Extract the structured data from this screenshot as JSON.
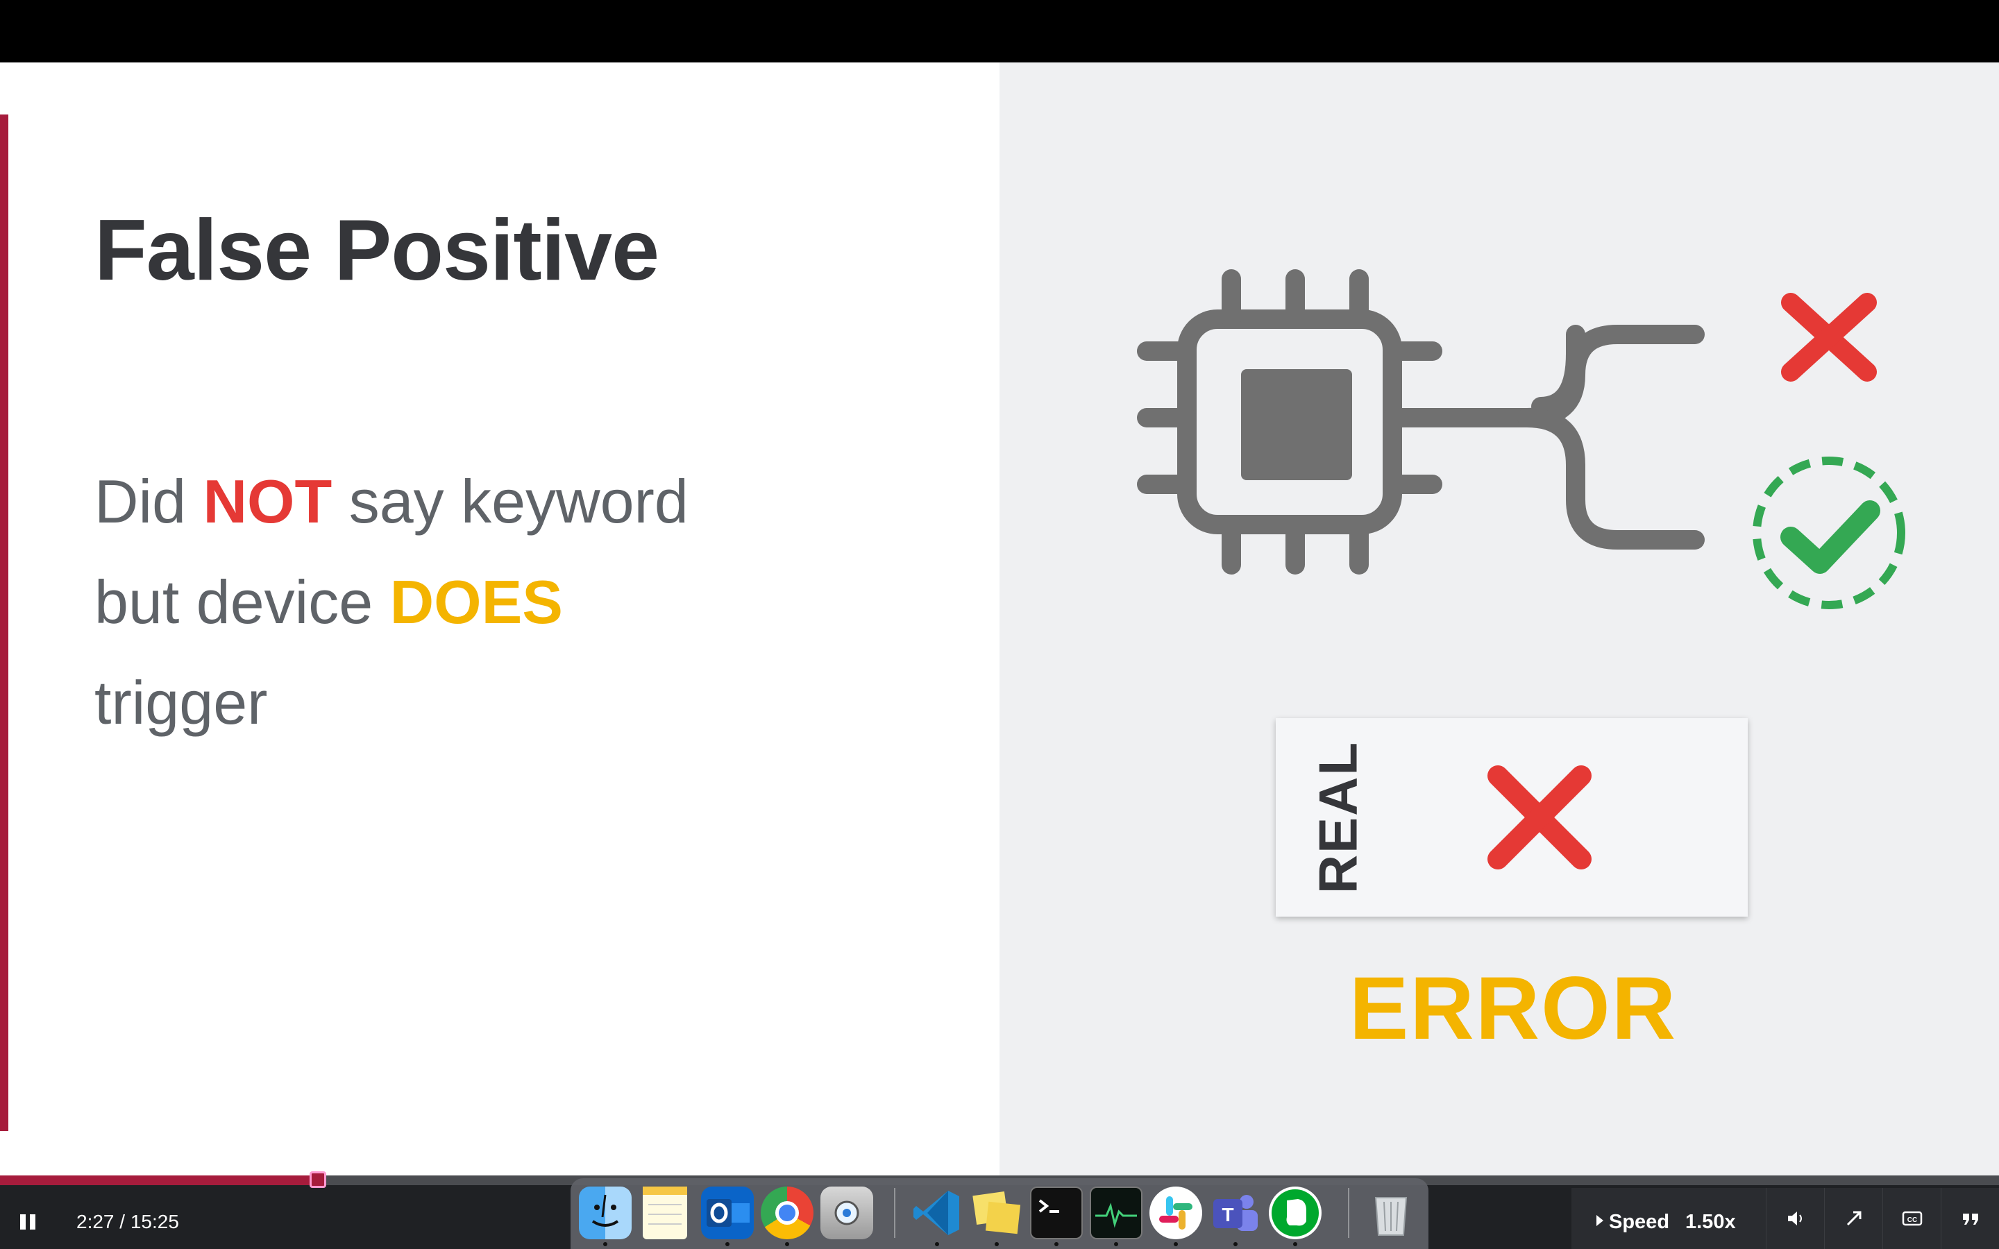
{
  "slide": {
    "title": "False Positive",
    "body": {
      "line1_a": "Did ",
      "line1_b": "NOT",
      "line1_c": " say keyword",
      "line2_a": "but device ",
      "line2_b": "DOES",
      "line3": "trigger"
    },
    "card_label": "REAL",
    "error_label": "ERROR"
  },
  "player": {
    "time": "2:27 / 15:25",
    "progress": 0.159,
    "speed_label": "Speed",
    "speed_value": "1.50x"
  },
  "dock": {
    "apps": [
      "finder-icon",
      "notes-icon",
      "outlook-icon",
      "chrome-icon",
      "disk-utility-icon",
      "vscode-icon",
      "stickies-icon",
      "terminal-icon",
      "activity-monitor-icon",
      "slack-icon",
      "teams-icon",
      "evernote-icon",
      "trash-icon"
    ]
  },
  "colors": {
    "accent": "#a61c3c",
    "red": "#e53935",
    "yellow": "#f4b400",
    "green": "#34a853",
    "icon_gray": "#707070"
  }
}
